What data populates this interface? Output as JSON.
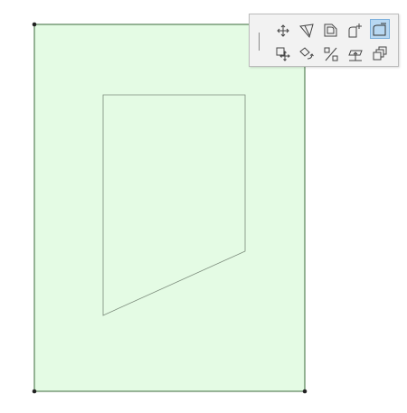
{
  "canvas": {
    "slab_fill_color": "#e4fbe4",
    "slab_edge_color": "#3a6a3a",
    "hole_edge_color": "#7c8c7c"
  },
  "pet_palette": {
    "row1": [
      {
        "icon": "move-node-icon"
      },
      {
        "icon": "offset-edge-icon"
      },
      {
        "icon": "fillet-chamfer-icon"
      },
      {
        "icon": "add-to-polygon-icon"
      },
      {
        "icon": "subtract-from-polygon-icon",
        "active": true
      }
    ],
    "row2": [
      {
        "icon": "drag-icon"
      },
      {
        "icon": "rotate-icon"
      },
      {
        "icon": "mirror-icon"
      },
      {
        "icon": "elevate-icon"
      },
      {
        "icon": "multiply-icon"
      }
    ],
    "active_color": "#b8d8f2"
  }
}
